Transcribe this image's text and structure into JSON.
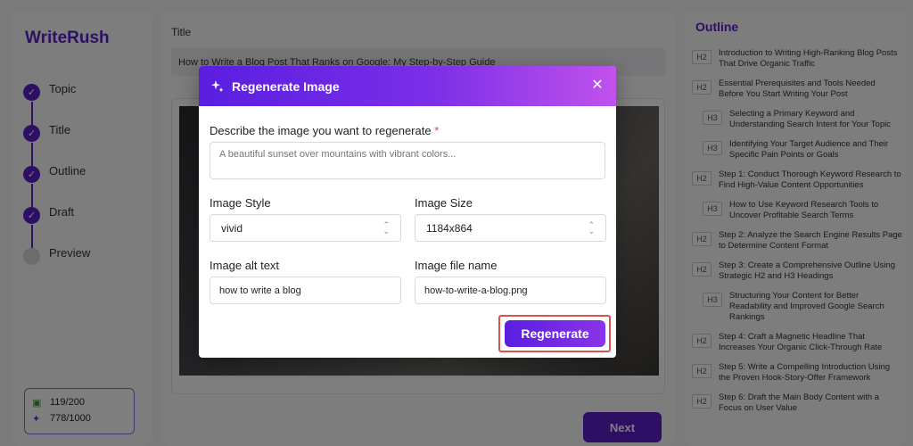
{
  "app": {
    "brand": "WriteRush"
  },
  "sidebar": {
    "steps": [
      {
        "label": "Topic",
        "done": true
      },
      {
        "label": "Title",
        "done": true
      },
      {
        "label": "Outline",
        "done": true
      },
      {
        "label": "Draft",
        "done": true
      },
      {
        "label": "Preview",
        "done": false
      }
    ],
    "credits": [
      {
        "icon": "document-credit-icon",
        "value": "119/200"
      },
      {
        "icon": "sparkle-credit-icon",
        "value": "778/1000"
      }
    ]
  },
  "main": {
    "title_label": "Title",
    "title_value": "How to Write a Blog Post That Ranks on Google: My Step-by-Step Guide",
    "next_label": "Next"
  },
  "outline": {
    "heading": "Outline",
    "items": [
      {
        "tag": "H2",
        "text": "Introduction to Writing High-Ranking Blog Posts That Drive Organic Traffic"
      },
      {
        "tag": "H2",
        "text": "Essential Prerequisites and Tools Needed Before You Start Writing Your Post"
      },
      {
        "tag": "H3",
        "text": "Selecting a Primary Keyword and Understanding Search Intent for Your Topic"
      },
      {
        "tag": "H3",
        "text": "Identifying Your Target Audience and Their Specific Pain Points or Goals"
      },
      {
        "tag": "H2",
        "text": "Step 1: Conduct Thorough Keyword Research to Find High-Value Content Opportunities"
      },
      {
        "tag": "H3",
        "text": "How to Use Keyword Research Tools to Uncover Profitable Search Terms"
      },
      {
        "tag": "H2",
        "text": "Step 2: Analyze the Search Engine Results Page to Determine Content Format"
      },
      {
        "tag": "H2",
        "text": "Step 3: Create a Comprehensive Outline Using Strategic H2 and H3 Headings"
      },
      {
        "tag": "H3",
        "text": "Structuring Your Content for Better Readability and Improved Google Search Rankings"
      },
      {
        "tag": "H2",
        "text": "Step 4: Craft a Magnetic Headline That Increases Your Organic Click-Through Rate"
      },
      {
        "tag": "H2",
        "text": "Step 5: Write a Compelling Introduction Using the Proven Hook-Story-Offer Framework"
      },
      {
        "tag": "H2",
        "text": "Step 6: Draft the Main Body Content with a Focus on User Value"
      }
    ]
  },
  "modal": {
    "title": "Regenerate Image",
    "describe_label": "Describe the image you want to regenerate",
    "required_mark": "*",
    "describe_placeholder": "A beautiful sunset over mountains with vibrant colors...",
    "style_label": "Image Style",
    "style_value": "vivid",
    "size_label": "Image Size",
    "size_value": "1184x864",
    "alt_label": "Image alt text",
    "alt_value": "how to write a blog",
    "file_label": "Image file name",
    "file_value": "how-to-write-a-blog.png",
    "regenerate_label": "Regenerate"
  }
}
